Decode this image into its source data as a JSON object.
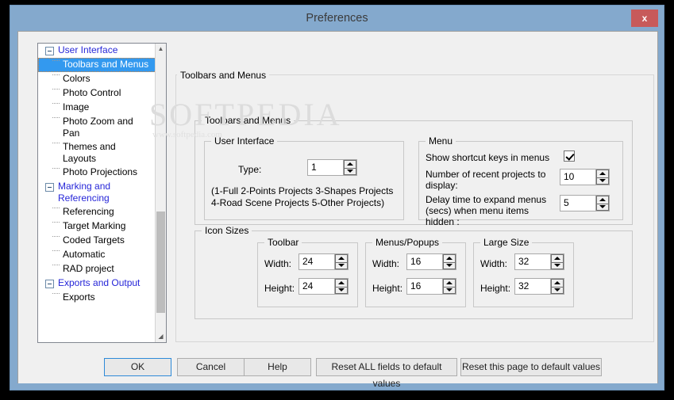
{
  "window": {
    "title": "Preferences",
    "close_label": "x",
    "titlebar_color": "#84a9cd",
    "close_color": "#c75a5a"
  },
  "watermark": {
    "main": "SOFTPEDIA",
    "sub": "www.softpedia.com"
  },
  "sidebar": {
    "items": [
      {
        "label": "User Interface",
        "type": "group",
        "expander": "minus-icon"
      },
      {
        "label": "Toolbars and Menus",
        "type": "child",
        "selected": true
      },
      {
        "label": "Colors",
        "type": "child"
      },
      {
        "label": "Photo Control",
        "type": "child"
      },
      {
        "label": "Image",
        "type": "child"
      },
      {
        "label": "Photo Zoom and Pan",
        "type": "child"
      },
      {
        "label": "Themes and Layouts",
        "type": "child"
      },
      {
        "label": "Photo Projections",
        "type": "child"
      },
      {
        "label": "Marking and Referencing",
        "type": "group",
        "expander": "minus-icon"
      },
      {
        "label": "Referencing",
        "type": "child"
      },
      {
        "label": "Target Marking",
        "type": "child"
      },
      {
        "label": "Coded Targets",
        "type": "child"
      },
      {
        "label": "Automatic",
        "type": "child"
      },
      {
        "label": "RAD project",
        "type": "child"
      },
      {
        "label": "Exports and Output",
        "type": "group",
        "expander": "minus-icon"
      },
      {
        "label": "Exports",
        "type": "child"
      }
    ]
  },
  "page": {
    "header": "Toolbars and Menus"
  },
  "groups": {
    "toolbars_and_menus": "Toolbars and Menus",
    "user_interface": "User Interface",
    "menu": "Menu",
    "icon_sizes": "Icon Sizes",
    "toolbar": "Toolbar",
    "menus_popups": "Menus/Popups",
    "large_size": "Large Size"
  },
  "user_interface": {
    "type_label": "Type:",
    "type_value": "1",
    "hint": "(1-Full 2-Points Projects 3-Shapes Projects 4-Road Scene Projects 5-Other Projects)"
  },
  "menu": {
    "shortcut_label": "Show shortcut keys in menus",
    "shortcut_checked": true,
    "recent_label": "Number of recent projects to display:",
    "recent_value": "10",
    "delay_label": "Delay time to expand menus (secs) when menu items hidden :",
    "delay_value": "5"
  },
  "icon_sizes": {
    "width_label": "Width:",
    "height_label": "Height:",
    "toolbar": {
      "width": "24",
      "height": "24"
    },
    "menus_popups": {
      "width": "16",
      "height": "16"
    },
    "large_size": {
      "width": "32",
      "height": "32"
    }
  },
  "buttons": {
    "ok": "OK",
    "cancel": "Cancel",
    "help": "Help",
    "reset_all": "Reset ALL fields to default values",
    "reset_page": "Reset this page to default values"
  },
  "scrollbar": {
    "up": "▲",
    "down": "◢"
  }
}
